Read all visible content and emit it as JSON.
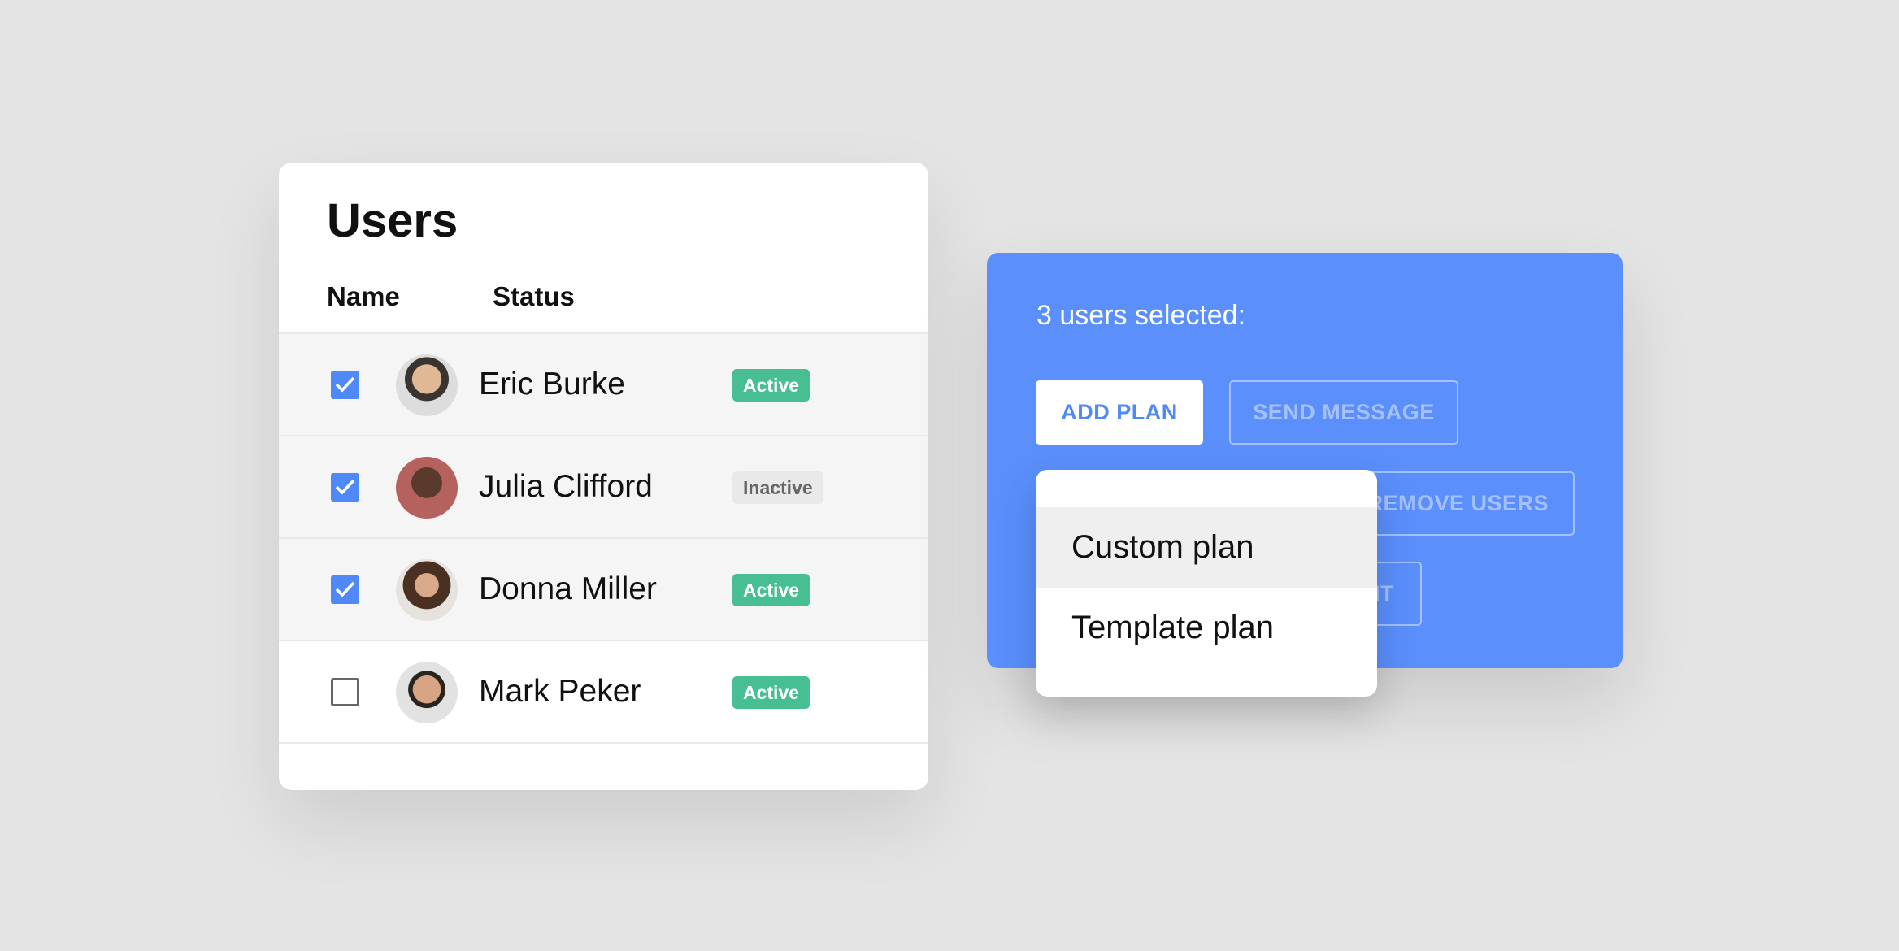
{
  "users_card": {
    "title": "Users",
    "columns": {
      "name": "Name",
      "status": "Status"
    },
    "rows": [
      {
        "name": "Eric Burke",
        "status": "Active",
        "checked": true
      },
      {
        "name": "Julia Clifford",
        "status": "Inactive",
        "checked": true
      },
      {
        "name": "Donna Miller",
        "status": "Active",
        "checked": true
      },
      {
        "name": "Mark Peker",
        "status": "Active",
        "checked": false
      }
    ]
  },
  "action_panel": {
    "selection_text": "3 users selected:",
    "buttons": {
      "add_plan": "ADD PLAN",
      "send_message": "SEND MESSAGE",
      "remove_users": "REMOVE USERS",
      "third": "IT"
    }
  },
  "plan_dropdown": {
    "options": [
      {
        "label": "Custom plan",
        "highlighted": true
      },
      {
        "label": "Template plan",
        "highlighted": false
      }
    ]
  },
  "colors": {
    "accent": "#5a8ffc",
    "checkbox": "#4f89f7",
    "active_badge": "#47bf92",
    "inactive_badge": "#e9e9e9",
    "background": "#e4e4e4"
  }
}
